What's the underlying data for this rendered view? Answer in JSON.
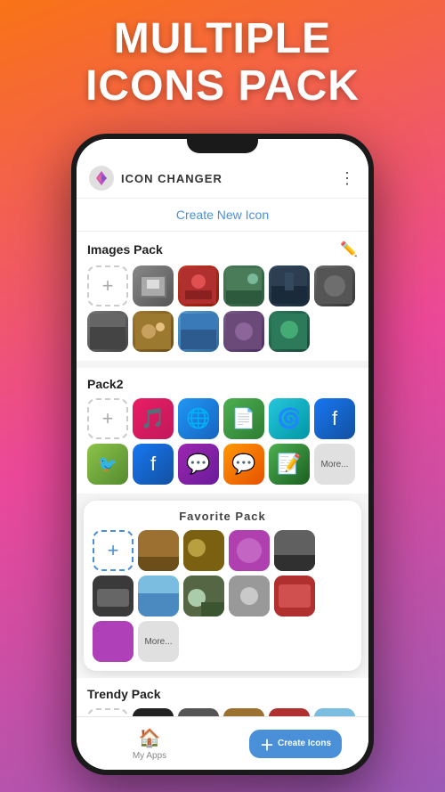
{
  "hero": {
    "line1": "MULTIPLE",
    "line2": "ICONS PACK"
  },
  "appbar": {
    "title": "ICON CHANGER",
    "more": "⋮"
  },
  "create_button": {
    "label": "Create New Icon"
  },
  "sections": [
    {
      "id": "images-pack",
      "title": "Images Pack",
      "has_edit": true
    },
    {
      "id": "pack2",
      "title": "Pack2",
      "has_edit": false
    },
    {
      "id": "trendy-pack",
      "title": "Trendy Pack",
      "has_edit": false
    }
  ],
  "favorite_pack": {
    "title": "Favorite Pack"
  },
  "bottom_nav": {
    "apps_label": "My Apps",
    "create_label": "Create Icons"
  },
  "colors": {
    "accent": "#4a90d9",
    "gradient_start": "#f97316",
    "gradient_end": "#9b59b6"
  }
}
